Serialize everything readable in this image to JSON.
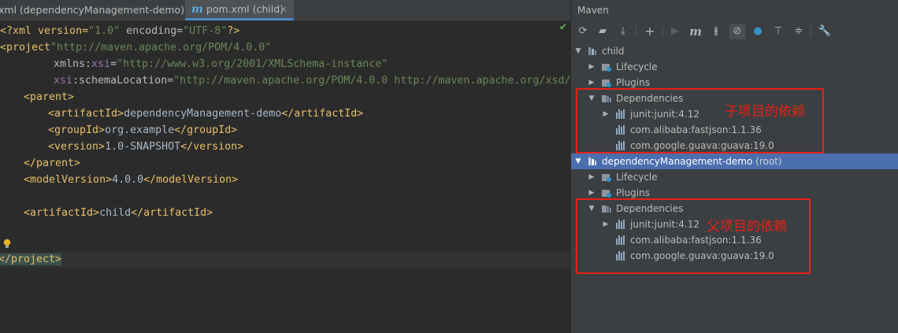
{
  "editor": {
    "tabs": [
      {
        "label": "xml (dependencyManagement-demo)",
        "active": false
      },
      {
        "label": "pom.xml (child)",
        "icon": "m",
        "active": true
      }
    ],
    "code": {
      "l1": {
        "a": "<?xml version=",
        "b": "\"1.0\"",
        "c": " encoding=",
        "d": "\"UTF-8\"",
        "e": "?>"
      },
      "l2": {
        "a": "<project",
        " b": " xmlns=",
        "c": "\"http://maven.apache.org/POM/4.0.0\""
      },
      "l3": {
        "a": "xmlns:",
        "b": "xsi",
        "c": "=",
        "d": "\"http://www.w3.org/2001/XMLSchema-instance\""
      },
      "l4": {
        "a": "xsi",
        "b": ":schemaLocation=",
        "c": "\"http://maven.apache.org/POM/4.0.0 http://maven.apache.org/xsd/"
      },
      "l5": "<parent>",
      "l6": {
        "a": "<artifactId>",
        "b": "dependencyManagement-demo",
        "c": "</artifactId>"
      },
      "l7": {
        "a": "<groupId>",
        "b": "org.example",
        "c": "</groupId>"
      },
      "l8": {
        "a": "<version>",
        "b": "1.0-SNAPSHOT",
        "c": "</version>"
      },
      "l9": "</parent>",
      "l10": {
        "a": "<modelVersion>",
        "b": "4.0.0",
        "c": "</modelVersion>"
      },
      "l11": {
        "a": "<artifactId>",
        "b": "child",
        "c": "</artifactId>"
      },
      "l12": "</project>"
    }
  },
  "maven": {
    "title": "Maven",
    "tree": {
      "child": "child",
      "lifecycle": "Lifecycle",
      "plugins": "Plugins",
      "dependencies": "Dependencies",
      "dep1": "junit:junit:4.12",
      "dep2": "com.alibaba:fastjson:1.1.36",
      "dep3": "com.google.guava:guava:19.0",
      "root": "dependencyManagement-demo",
      "root_suffix": " (root)"
    },
    "annotations": {
      "child": "子项目的依赖",
      "parent": "父项目的依赖"
    }
  },
  "colors": {
    "annotation": "#e62117",
    "selection": "#4b6eaf"
  }
}
